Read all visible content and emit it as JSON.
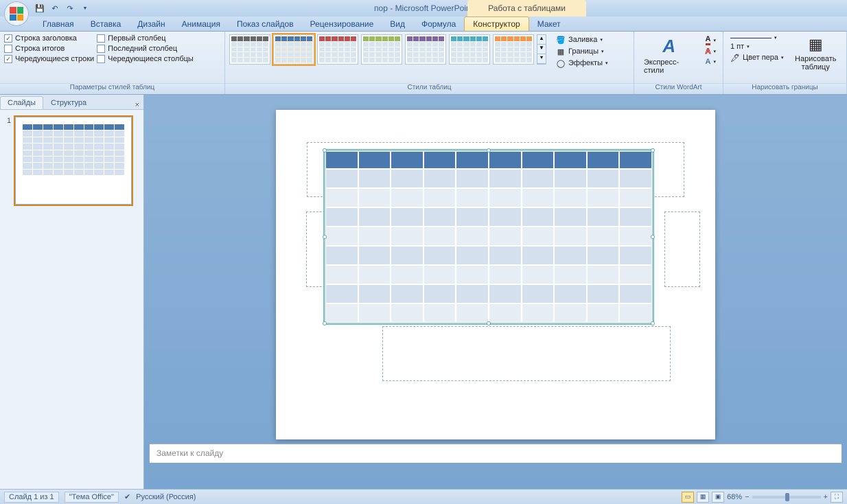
{
  "title": "пор - Microsoft PowerPoint",
  "context_tab": "Работа с таблицами",
  "tabs": {
    "home": "Главная",
    "insert": "Вставка",
    "design": "Дизайн",
    "animation": "Анимация",
    "slideshow": "Показ слайдов",
    "review": "Рецензирование",
    "view": "Вид",
    "formula": "Формула",
    "constructor": "Конструктор",
    "layout": "Макет"
  },
  "ribbon": {
    "options_group": "Параметры стилей таблиц",
    "styles_group": "Стили таблиц",
    "wordart_group": "Стили WordArt",
    "draw_group": "Нарисовать границы",
    "opt_header_row": "Строка заголовка",
    "opt_total_row": "Строка итогов",
    "opt_banded_rows": "Чередующиеся строки",
    "opt_first_col": "Первый столбец",
    "opt_last_col": "Последний столбец",
    "opt_banded_cols": "Чередующиеся столбцы",
    "fill": "Заливка",
    "borders": "Границы",
    "effects": "Эффекты",
    "quick_styles": "Экспресс-стили",
    "pen_weight": "1 пт",
    "pen_color": "Цвет пера",
    "draw_table": "Нарисовать таблицу"
  },
  "panel": {
    "slides": "Слайды",
    "outline": "Структура",
    "slide_num": "1"
  },
  "notes_placeholder": "Заметки к слайду",
  "status": {
    "slide": "Слайд 1 из 1",
    "theme": "\"Тема Office\"",
    "lang": "Русский (Россия)",
    "zoom": "68%"
  },
  "style_colors": [
    "#666",
    "#4a79b0",
    "#c0504d",
    "#9bbb59",
    "#8064a2",
    "#4bacc6",
    "#f79646"
  ]
}
